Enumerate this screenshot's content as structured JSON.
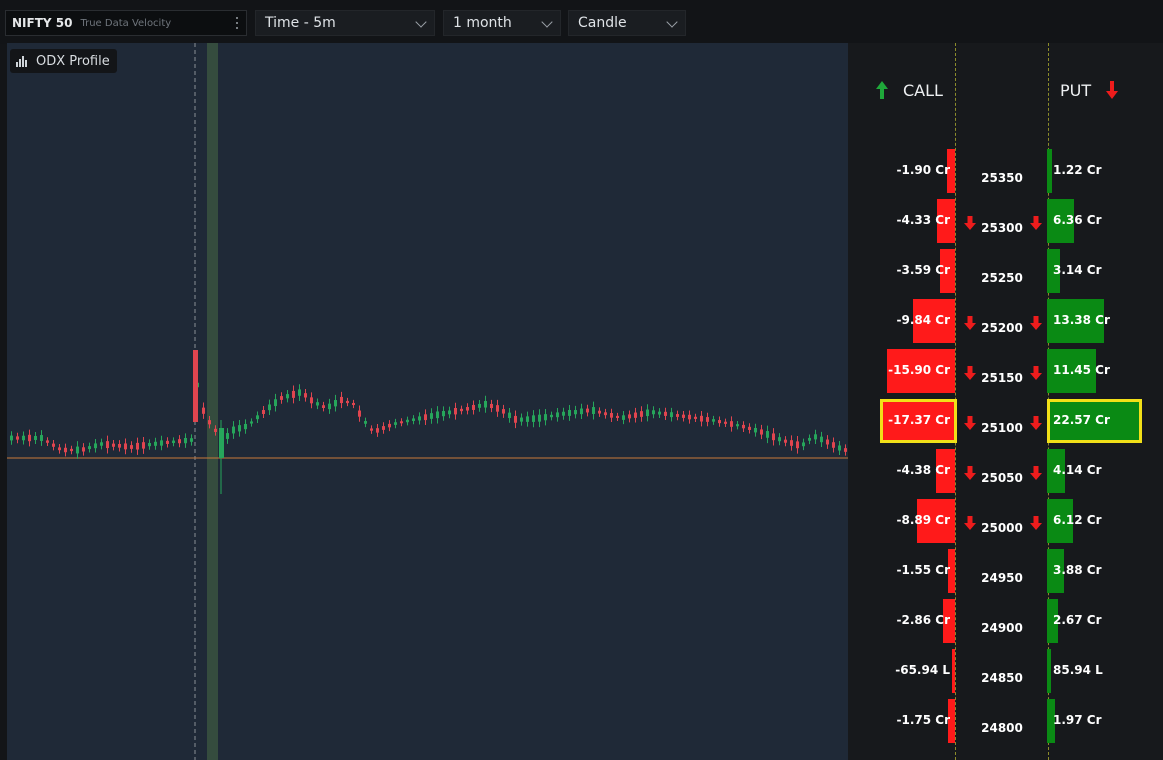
{
  "toolbar": {
    "symbol": "NIFTY 50",
    "symbol_sub": "True Data Velocity",
    "timeframe": "Time - 5m",
    "range": "1 month",
    "chart_type": "Candle"
  },
  "overlay": {
    "label": "ODX Profile"
  },
  "options": {
    "call_header": "CALL",
    "put_header": "PUT",
    "rows": [
      {
        "strike": "25350",
        "call": "-1.90 Cr",
        "put": "1.22 Cr",
        "call_mag": 1.9,
        "put_mag": 1.22,
        "call_arrow": false,
        "put_arrow": false,
        "highlight": false
      },
      {
        "strike": "25300",
        "call": "-4.33 Cr",
        "put": "6.36 Cr",
        "call_mag": 4.33,
        "put_mag": 6.36,
        "call_arrow": true,
        "put_arrow": true,
        "highlight": false
      },
      {
        "strike": "25250",
        "call": "-3.59 Cr",
        "put": "3.14 Cr",
        "call_mag": 3.59,
        "put_mag": 3.14,
        "call_arrow": false,
        "put_arrow": false,
        "highlight": false
      },
      {
        "strike": "25200",
        "call": "-9.84 Cr",
        "put": "13.38 Cr",
        "call_mag": 9.84,
        "put_mag": 13.38,
        "call_arrow": true,
        "put_arrow": true,
        "highlight": false
      },
      {
        "strike": "25150",
        "call": "-15.90 Cr",
        "put": "11.45 Cr",
        "call_mag": 15.9,
        "put_mag": 11.45,
        "call_arrow": true,
        "put_arrow": true,
        "highlight": false
      },
      {
        "strike": "25100",
        "call": "-17.37 Cr",
        "put": "22.57 Cr",
        "call_mag": 17.37,
        "put_mag": 22.57,
        "call_arrow": true,
        "put_arrow": true,
        "highlight": true
      },
      {
        "strike": "25050",
        "call": "-4.38 Cr",
        "put": "4.14 Cr",
        "call_mag": 4.38,
        "put_mag": 4.14,
        "call_arrow": true,
        "put_arrow": true,
        "highlight": false
      },
      {
        "strike": "25000",
        "call": "-8.89 Cr",
        "put": "6.12 Cr",
        "call_mag": 8.89,
        "put_mag": 6.12,
        "call_arrow": true,
        "put_arrow": true,
        "highlight": false
      },
      {
        "strike": "24950",
        "call": "-1.55 Cr",
        "put": "3.88 Cr",
        "call_mag": 1.55,
        "put_mag": 3.88,
        "call_arrow": false,
        "put_arrow": false,
        "highlight": false
      },
      {
        "strike": "24900",
        "call": "-2.86 Cr",
        "put": "2.67 Cr",
        "call_mag": 2.86,
        "put_mag": 2.67,
        "call_arrow": false,
        "put_arrow": false,
        "highlight": false
      },
      {
        "strike": "24850",
        "call": "-65.94 L",
        "put": "85.94 L",
        "call_mag": 0.66,
        "put_mag": 0.86,
        "call_arrow": false,
        "put_arrow": false,
        "highlight": false
      },
      {
        "strike": "24800",
        "call": "-1.75 Cr",
        "put": "1.97 Cr",
        "call_mag": 1.75,
        "put_mag": 1.97,
        "call_arrow": false,
        "put_arrow": false,
        "highlight": false
      }
    ]
  },
  "colors": {
    "call_bar": "#ff1a1a",
    "put_bar": "#0a8a14",
    "highlight": "#f2e018",
    "bull_candle": "#26a65b",
    "bear_candle": "#e0454f",
    "price_line": "#c8793a"
  },
  "icons": {
    "odx": "bar-chart-icon",
    "call": "arrow-up-icon",
    "put": "arrow-down-icon"
  }
}
